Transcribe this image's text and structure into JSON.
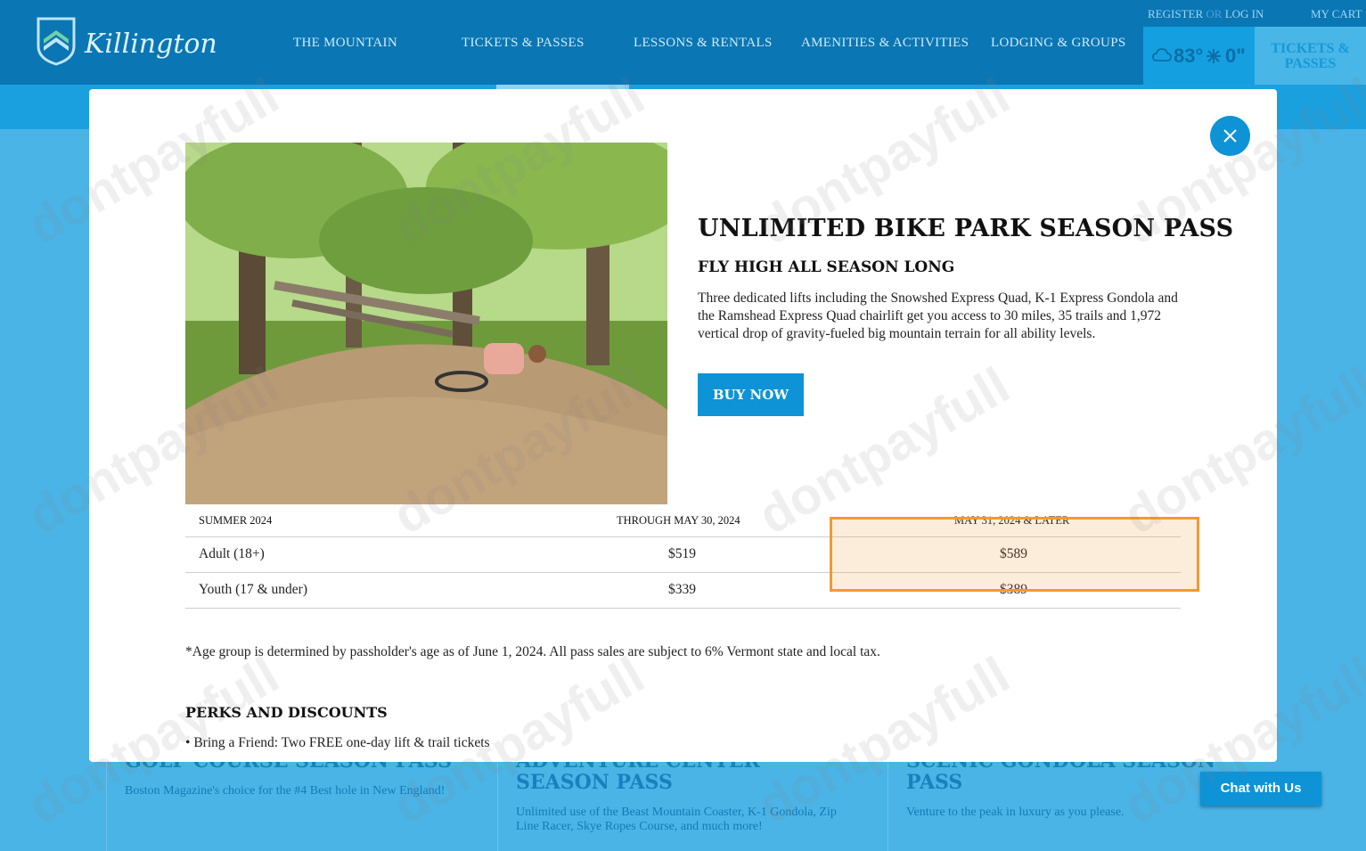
{
  "header": {
    "brand": "Killington",
    "nav": [
      "THE MOUNTAIN",
      "TICKETS & PASSES",
      "LESSONS & RENTALS",
      "AMENITIES & ACTIVITIES",
      "LODGING & GROUPS"
    ],
    "register": "REGISTER",
    "or": "OR",
    "login": "LOG IN",
    "cart": "MY CART",
    "weather_temp": "83°",
    "weather_snow": "0\"",
    "tickets_button": "TICKETS & PASSES"
  },
  "background_cards": [
    {
      "title": "GOLF COURSE SEASON PASS",
      "text": "Boston Magazine's choice for the #4 Best hole in New England!"
    },
    {
      "title": "ADVENTURE CENTER SEASON PASS",
      "text": "Unlimited use of the Beast Mountain Coaster, K-1 Gondola, Zip Line Racer, Skye Ropes Course, and much more!"
    },
    {
      "title": "SCENIC GONDOLA SEASON PASS",
      "text": "Venture to the peak in luxury as you please."
    }
  ],
  "modal": {
    "title": "UNLIMITED BIKE PARK SEASON PASS",
    "subtitle": "FLY HIGH ALL SEASON LONG",
    "description": "Three dedicated lifts including the Snowshed Express Quad, K-1 Express Gondola and the Ramshead Express Quad chairlift get you access to 30 miles, 35 trails and 1,972 vertical drop of gravity-fueled big mountain terrain for all ability levels.",
    "buy_label": "BUY NOW",
    "table": {
      "headers": [
        "SUMMER 2024",
        "THROUGH MAY 30, 2024",
        "MAY 31, 2024 & LATER"
      ],
      "rows": [
        {
          "label": "Adult (18+)",
          "early": "$519",
          "late": "$589"
        },
        {
          "label": "Youth (17 & under)",
          "early": "$339",
          "late": "$389"
        }
      ]
    },
    "note": "*Age group is determined by passholder's age as of June 1, 2024.  All pass sales are subject to 6% Vermont state and local tax.",
    "perks_title": "PERKS AND DISCOUNTS",
    "perks": [
      "Bring a Friend: Two FREE one-day lift & trail tickets"
    ]
  },
  "chat_label": "Chat with Us",
  "watermark": "dontpayfull",
  "colors": {
    "brand_blue": "#0a76b4",
    "accent": "#0d93d6",
    "highlight": "#f09a34"
  }
}
